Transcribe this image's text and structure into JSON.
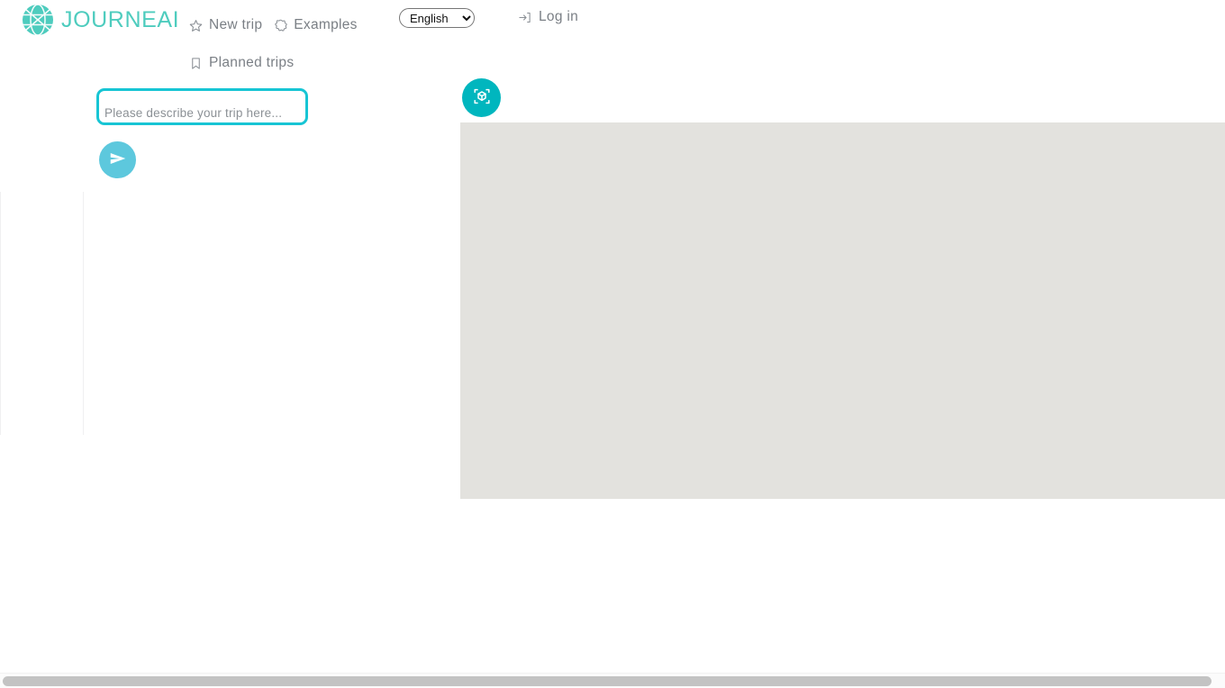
{
  "brand": {
    "name": "JOURNEAI",
    "logo_icon": "globe-icon",
    "accent_color": "#4ECCBE"
  },
  "header": {
    "nav_items": [
      {
        "label": "New trip",
        "icon": "star-icon"
      },
      {
        "label": "Examples",
        "icon": "puzzle-star-icon"
      },
      {
        "label": "Planned trips",
        "icon": "bookmark-icon"
      }
    ],
    "language": {
      "selected": "English",
      "options": [
        "English"
      ],
      "icon": "chevron-down-icon"
    },
    "login": {
      "label": "Log in",
      "icon": "login-arrow-icon"
    }
  },
  "prompt": {
    "placeholder": "Please describe your trip here...",
    "value": "",
    "border_color": "#17C5D4",
    "send_button": {
      "icon": "send-paper-plane-icon",
      "color": "#5DC8DD"
    }
  },
  "viewer": {
    "toggle_button": {
      "icon": "cube-3d-icon",
      "color": "#00B6BE"
    },
    "map_placeholder_color": "#E3E2DE"
  },
  "scrollbar": {
    "orientation": "horizontal",
    "thumb_color": "#c3c3c3"
  }
}
